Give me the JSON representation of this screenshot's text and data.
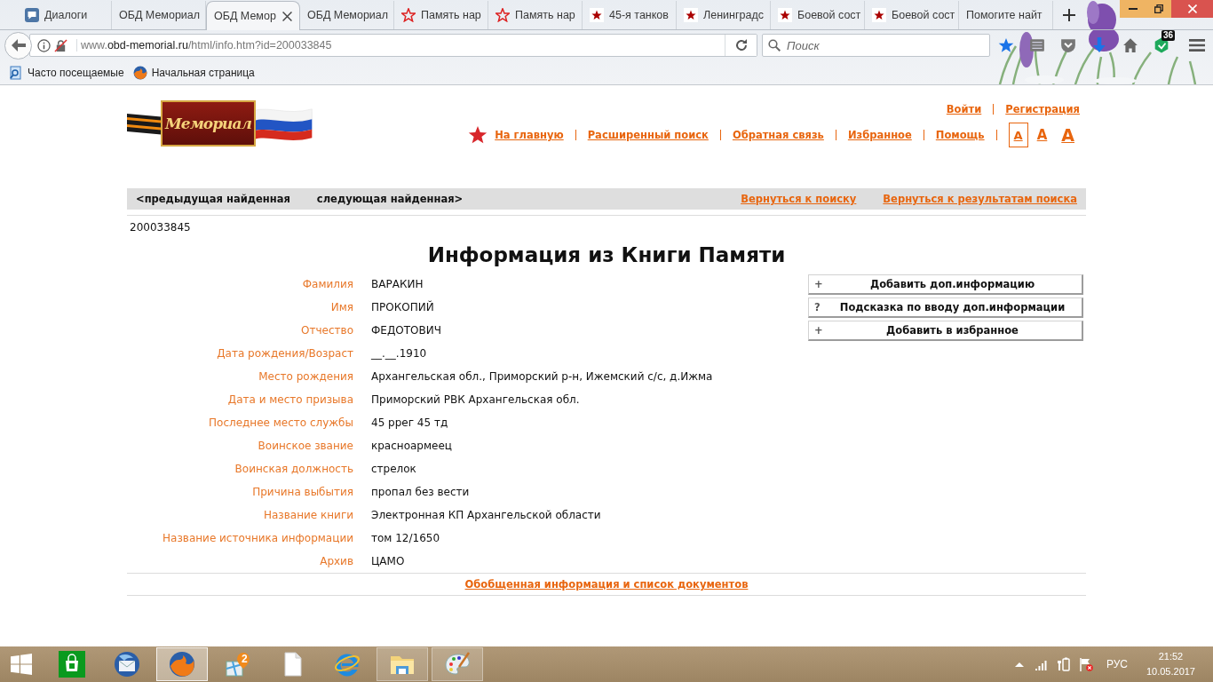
{
  "browser": {
    "tabs": [
      {
        "title": "Диалоги",
        "kind": "chat",
        "selected": false
      },
      {
        "title": "ОБД Мемориал",
        "kind": "plain",
        "selected": false
      },
      {
        "title": "ОБД Мемор",
        "kind": "plain",
        "selected": true
      },
      {
        "title": "ОБД Мемориал",
        "kind": "plain",
        "selected": false
      },
      {
        "title": "Память нар",
        "kind": "star-outline",
        "selected": false
      },
      {
        "title": "Память нар",
        "kind": "star-outline",
        "selected": false
      },
      {
        "title": "45-я танков",
        "kind": "star",
        "selected": false
      },
      {
        "title": "Ленинградс",
        "kind": "star",
        "selected": false
      },
      {
        "title": "Боевой сост",
        "kind": "star",
        "selected": false
      },
      {
        "title": "Боевой сост",
        "kind": "star",
        "selected": false
      },
      {
        "title": "Помогите найт",
        "kind": "plain",
        "selected": false
      }
    ],
    "address": {
      "prefix": "www.",
      "host": "obd-memorial.ru",
      "path": "/html/info.htm?id=200033845"
    },
    "search": {
      "placeholder": "Поиск"
    },
    "extension_badge": "36",
    "bookmarks": [
      {
        "label": "Часто посещаемые",
        "kind": "page"
      },
      {
        "label": "Начальная страница",
        "kind": "globe"
      }
    ]
  },
  "site": {
    "logo_text": "Мемориал",
    "account_links": [
      "Войти",
      "Регистрация"
    ],
    "nav_links": [
      "На главную",
      "Расширенный поиск",
      "Обратная связь",
      "Избранное",
      "Помощь"
    ],
    "font_sizes": [
      {
        "label": "A",
        "kind": "small",
        "selected": true
      },
      {
        "label": "A",
        "kind": "medium",
        "selected": false
      },
      {
        "label": "A",
        "kind": "large",
        "selected": false
      }
    ],
    "pager": {
      "previous": "<предыдущая найденная",
      "next": "следующая найденная>",
      "back_links": [
        "Вернуться к поиску",
        "Вернуться к результатам поиска"
      ]
    },
    "record_id": "200033845",
    "title": "Информация из Книги Памяти",
    "fields": [
      {
        "label": "Фамилия",
        "value": "ВАРАКИН"
      },
      {
        "label": "Имя",
        "value": "ПРОКОПИЙ"
      },
      {
        "label": "Отчество",
        "value": "ФЕДОТОВИЧ"
      },
      {
        "label": "Дата рождения/Возраст",
        "value": "__.__.1910"
      },
      {
        "label": "Место рождения",
        "value": "Архангельская обл., Приморский р-н, Ижемский с/с, д.Ижма"
      },
      {
        "label": "Дата и место призыва",
        "value": "Приморский РВК Архангельская обл."
      },
      {
        "label": "Последнее место службы",
        "value": "45 ррег 45 тд"
      },
      {
        "label": "Воинское звание",
        "value": "красноармеец"
      },
      {
        "label": "Воинская должность",
        "value": "стрелок"
      },
      {
        "label": "Причина выбытия",
        "value": "пропал без вести"
      },
      {
        "label": "Название книги",
        "value": "Электронная КП Архангельской области"
      },
      {
        "label": "Название источника информации",
        "value": "том 12/1650"
      },
      {
        "label": "Архив",
        "value": "ЦАМО"
      }
    ],
    "actions": [
      {
        "mark": "+",
        "label": "Добавить доп.информацию"
      },
      {
        "mark": "?",
        "label": "Подсказка по вводу доп.информации"
      },
      {
        "mark": "+",
        "label": "Добавить в избранное"
      }
    ],
    "summary_link": "Обобщенная информация и список документов"
  },
  "taskbar": {
    "apps": [
      {
        "kind": "start",
        "selected": false,
        "running": false
      },
      {
        "kind": "store",
        "selected": false,
        "running": false
      },
      {
        "kind": "mail",
        "selected": false,
        "running": false
      },
      {
        "kind": "browser",
        "selected": true,
        "running": true
      },
      {
        "kind": "maps",
        "badge": "2",
        "selected": false,
        "running": false
      },
      {
        "kind": "document",
        "selected": false,
        "running": false
      },
      {
        "kind": "web",
        "selected": false,
        "running": false
      },
      {
        "kind": "folder",
        "selected": false,
        "running": true
      },
      {
        "kind": "paint",
        "selected": false,
        "running": true
      }
    ],
    "tray": {
      "language": "РУС",
      "time": "21:52",
      "date": "10.05.2017"
    }
  }
}
